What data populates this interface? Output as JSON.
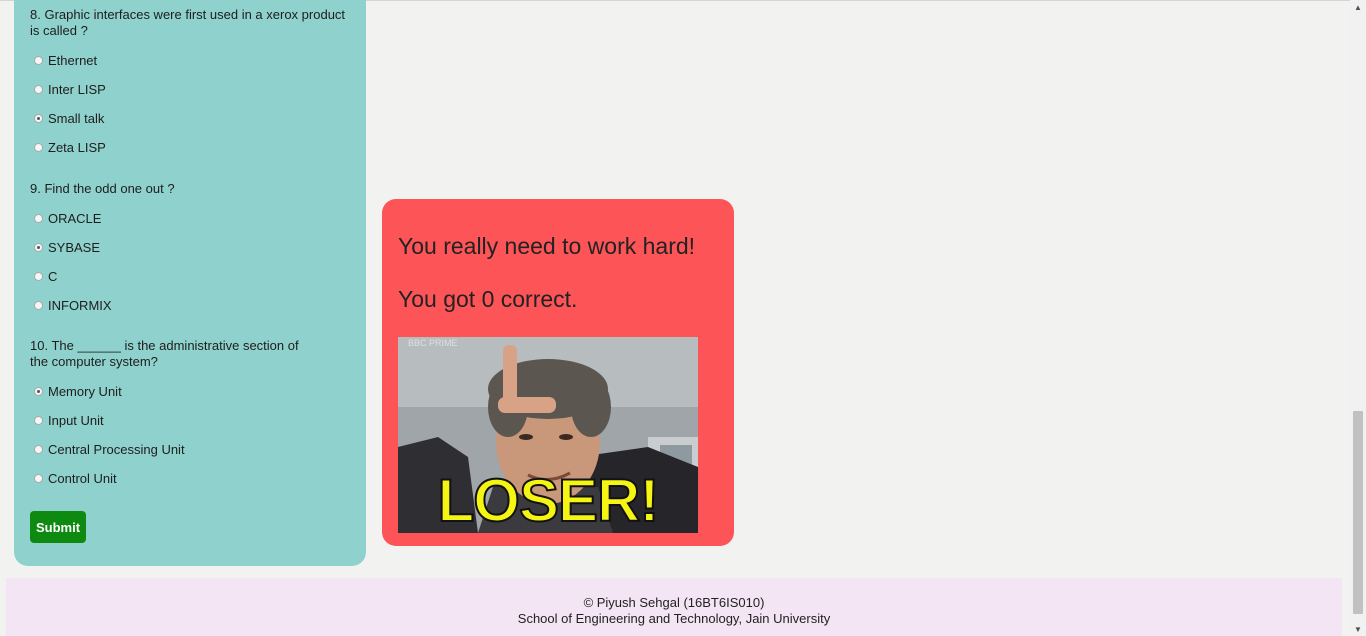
{
  "quiz": {
    "questions": [
      {
        "text": "8. Graphic interfaces were first used in a xerox product is called ?",
        "options": [
          {
            "label": "Ethernet",
            "checked": false
          },
          {
            "label": "Inter LISP",
            "checked": false
          },
          {
            "label": "Small talk",
            "checked": true
          },
          {
            "label": "Zeta LISP",
            "checked": false
          }
        ]
      },
      {
        "text": "9. Find the odd one out ?",
        "options": [
          {
            "label": "ORACLE",
            "checked": false
          },
          {
            "label": "SYBASE",
            "checked": true
          },
          {
            "label": "C",
            "checked": false
          },
          {
            "label": "INFORMIX",
            "checked": false
          }
        ]
      },
      {
        "text": "10. The ______ is the administrative section of the computer system?",
        "options": [
          {
            "label": "Memory Unit",
            "checked": true
          },
          {
            "label": "Input Unit",
            "checked": false
          },
          {
            "label": "Central Processing Unit",
            "checked": false
          },
          {
            "label": "Control Unit",
            "checked": false
          }
        ]
      }
    ],
    "submit_label": "Submit"
  },
  "result": {
    "message": "You really need to work hard!",
    "score_text": "You got 0 correct.",
    "gif": {
      "caption": "LOSER!",
      "watermark": "BBC PRIME"
    }
  },
  "footer": {
    "line1": "© Piyush Sehgal (16BT6IS010)",
    "line2": "School of Engineering and Technology, Jain University"
  },
  "colors": {
    "quiz_panel": "#8fd1cc",
    "result_card": "#fd5457",
    "submit_button": "#0e8a10",
    "footer_bg": "#f3e5f3",
    "gif_caption": "#f5f514"
  }
}
